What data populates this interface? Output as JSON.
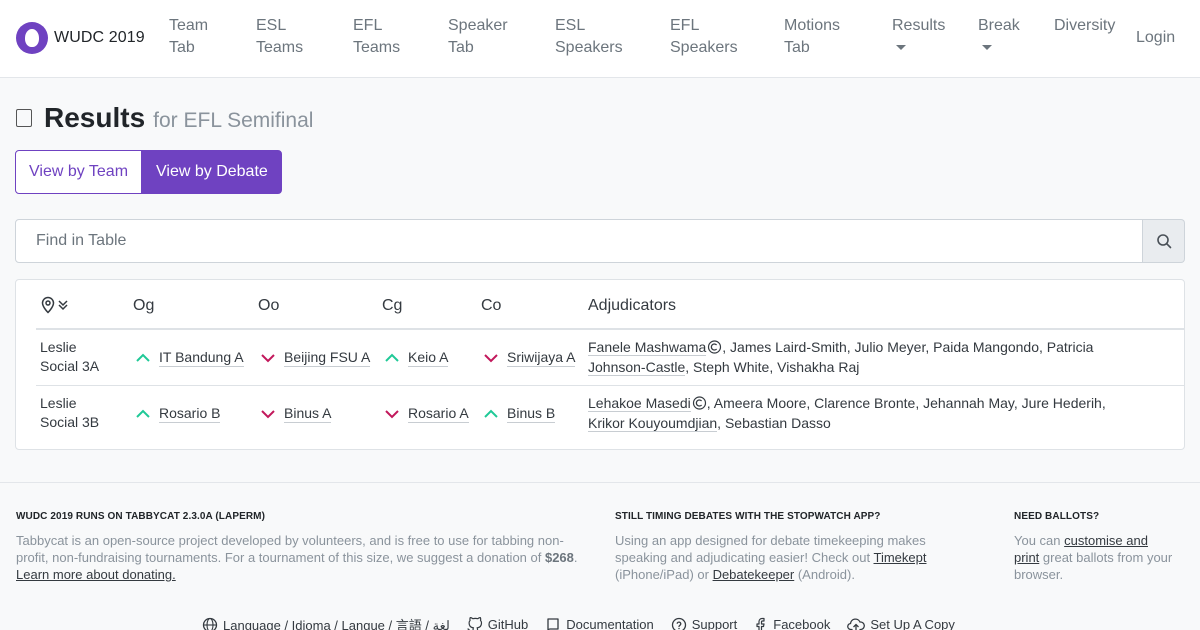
{
  "brand": {
    "name": "WUDC 2019"
  },
  "nav": {
    "items": [
      {
        "l1": "Team",
        "l2": "Tab"
      },
      {
        "l1": "ESL",
        "l2": "Teams"
      },
      {
        "l1": "EFL",
        "l2": "Teams"
      },
      {
        "l1": "Speaker",
        "l2": "Tab"
      },
      {
        "l1": "ESL",
        "l2": "Speakers"
      },
      {
        "l1": "EFL",
        "l2": "Speakers"
      },
      {
        "l1": "Motions",
        "l2": "Tab"
      },
      {
        "l1": "Results"
      },
      {
        "l1": "Break"
      },
      {
        "l1": "Diversity"
      }
    ],
    "login": "Login"
  },
  "header": {
    "title": "Results",
    "subtitle": "for EFL Semifinal"
  },
  "toggle": {
    "team": "View by Team",
    "debate": "View by Debate"
  },
  "search": {
    "placeholder": "Find in Table"
  },
  "table": {
    "columns": [
      "Og",
      "Oo",
      "Cg",
      "Co",
      "Adjudicators"
    ],
    "rows": [
      {
        "venue1": "Leslie",
        "venue2": "Social 3A",
        "teams": [
          {
            "name": "IT Bandung A",
            "result": "up"
          },
          {
            "name": "Beijing FSU A",
            "result": "down"
          },
          {
            "name": "Keio A",
            "result": "up"
          },
          {
            "name": "Sriwijaya A",
            "result": "down"
          }
        ],
        "adj_line1": [
          "Fanele Mashwama",
          ", James Laird-Smith",
          ", Julio Meyer",
          ", Paida Mangondo",
          ", Patricia"
        ],
        "adj_line2": [
          "Johnson-Castle",
          ", Steph White",
          ", Vishakha Raj"
        ]
      },
      {
        "venue1": "Leslie",
        "venue2": "Social 3B",
        "teams": [
          {
            "name": "Rosario B",
            "result": "up"
          },
          {
            "name": "Binus A",
            "result": "down"
          },
          {
            "name": "Rosario A",
            "result": "down"
          },
          {
            "name": "Binus B",
            "result": "up"
          }
        ],
        "adj_line1": [
          "Lehakoe Masedi",
          ", Ameera Moore",
          ", Clarence Bronte",
          ", Jehannah May",
          ", Jure Hederih,"
        ],
        "adj_line2": [
          "Krikor Kouyoumdjian",
          ", Sebastian Dasso"
        ]
      }
    ]
  },
  "footer": {
    "col1": {
      "heading": "WUDC 2019 runs on Tabbycat 2.3.0a (Laperm)",
      "text1": "Tabbycat is an open-source project developed by volunteers, and is free to use for tabbing non-profit, non-fundraising tournaments. For a tournament of this size, we suggest a donation of ",
      "amount": "$268",
      "text2": ". ",
      "link": "Learn more about donating."
    },
    "col2": {
      "heading": "Still timing debates with the stopwatch app?",
      "text1": "Using an app designed for debate timekeeping makes speaking and adjudicating easier! Check out ",
      "link1": "Timekept",
      "text2": " (iPhone/iPad) or ",
      "link2": "Debatekeeper",
      "text3": " (Android)."
    },
    "col3": {
      "heading": "Need ballots?",
      "text1": "You can ",
      "link": "customise and print",
      "text2": " great ballots from your browser."
    },
    "links": [
      "Language / Idioma / Langue / 言語 / لغة",
      "GitHub",
      "Documentation",
      "Support",
      "Facebook",
      "Set Up A Copy"
    ]
  },
  "colors": {
    "accent": "#6f42c1",
    "win": "#20c997",
    "loss": "#c2185b"
  }
}
